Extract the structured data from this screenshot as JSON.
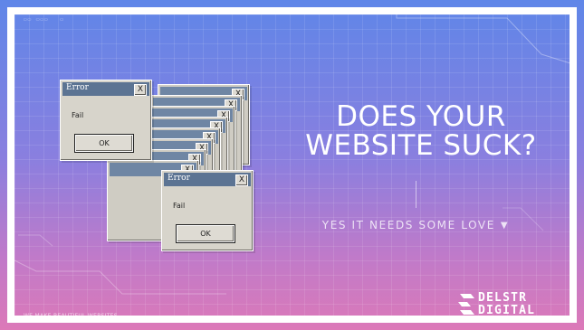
{
  "top_nav": {
    "items": [
      "▭▭ ▭▭▭",
      "▭"
    ]
  },
  "dialogs": {
    "title": "Error",
    "message": "Fail",
    "ok_label": "OK",
    "close_symbol": "X"
  },
  "hero": {
    "headline_line1": "DOES YOUR",
    "headline_line2": "WEBSITE SUCK?",
    "cta_label": "YES IT NEEDS SOME LOVE"
  },
  "footer": {
    "note": "WE MAKE BEAUTIFUL WEBSITES"
  },
  "logo": {
    "line1": "DELSTR",
    "line2": "DIGITAL"
  },
  "colors": {
    "bg_top": "#5f86e8",
    "bg_bottom": "#dc79b8",
    "titlebar": "#5c7493",
    "text": "#ffffff"
  },
  "icons": [
    "close-icon",
    "chevron-down-icon",
    "logo-mark-icon"
  ]
}
